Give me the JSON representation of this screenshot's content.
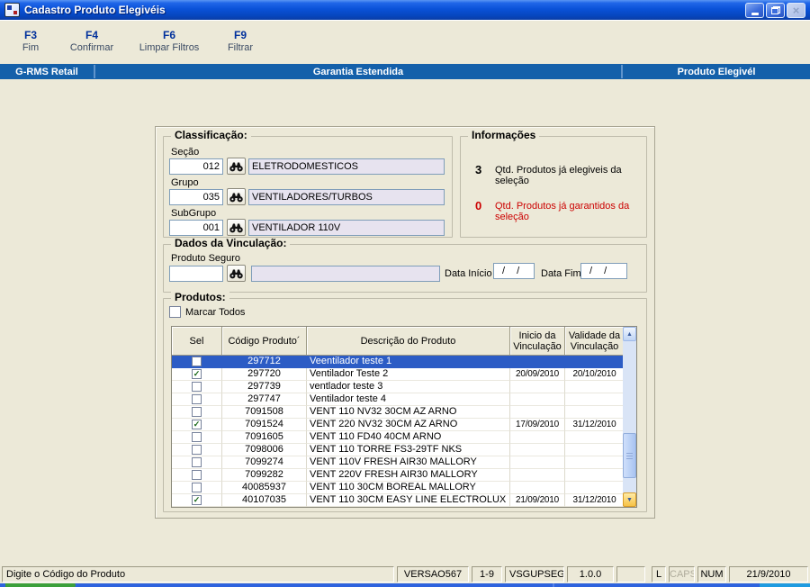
{
  "window": {
    "title": "Cadastro Produto Elegivéis"
  },
  "toolbar": {
    "buttons": [
      {
        "key": "F3",
        "label": "Fim"
      },
      {
        "key": "F4",
        "label": "Confirmar"
      },
      {
        "key": "F6",
        "label": "Limpar Filtros"
      },
      {
        "key": "F9",
        "label": "Filtrar"
      }
    ]
  },
  "banner": {
    "left": "G-RMS Retail",
    "center": "Garantia Estendida",
    "right": "Produto Elegivél"
  },
  "classificacao": {
    "title": "Classificação:",
    "secao": {
      "label": "Seção",
      "code": "012",
      "description": "ELETRODOMESTICOS"
    },
    "grupo": {
      "label": "Grupo",
      "code": "035",
      "description": "VENTILADORES/TURBOS"
    },
    "subgrupo": {
      "label": "SubGrupo",
      "code": "001",
      "description": "VENTILADOR 110V"
    }
  },
  "informacoes": {
    "title": "Informações",
    "elegiveis": {
      "count": "3",
      "label": "Qtd. Produtos já elegiveis da seleção"
    },
    "garantidos": {
      "count": "0",
      "label": "Qtd. Produtos já garantidos da seleção"
    }
  },
  "vinculacao": {
    "title": "Dados da Vinculação:",
    "produto_seguro_label": "Produto Seguro",
    "produto_seguro_code": "",
    "produto_seguro_description": "",
    "data_inicio": {
      "label": "Data Início",
      "value": "/ /"
    },
    "data_fim": {
      "label": "Data Fim",
      "value": "/ /"
    }
  },
  "produtos": {
    "title": "Produtos:",
    "marcar_todos_label": "Marcar Todos",
    "columns": {
      "sel": "Sel",
      "codigo": "Código Produto",
      "sort_mark": "´",
      "descricao": "Descrição do Produto",
      "inicio": "Inicio da Vinculação",
      "validade": "Validade da Vinculação"
    },
    "rows": [
      {
        "checked": false,
        "selected": true,
        "code": "297712",
        "desc": "Veentilador teste 1",
        "start": "",
        "end": ""
      },
      {
        "checked": true,
        "selected": false,
        "code": "297720",
        "desc": "Ventilador Teste 2",
        "start": "20/09/2010",
        "end": "20/10/2010"
      },
      {
        "checked": false,
        "selected": false,
        "code": "297739",
        "desc": "ventlador teste 3",
        "start": "",
        "end": ""
      },
      {
        "checked": false,
        "selected": false,
        "code": "297747",
        "desc": "Ventilador teste 4",
        "start": "",
        "end": ""
      },
      {
        "checked": false,
        "selected": false,
        "code": "7091508",
        "desc": "VENT 110 NV32 30CM AZ ARNO",
        "start": "",
        "end": ""
      },
      {
        "checked": true,
        "selected": false,
        "code": "7091524",
        "desc": "VENT 220 NV32 30CM AZ ARNO",
        "start": "17/09/2010",
        "end": "31/12/2010"
      },
      {
        "checked": false,
        "selected": false,
        "code": "7091605",
        "desc": "VENT 110 FD40 40CM ARNO",
        "start": "",
        "end": ""
      },
      {
        "checked": false,
        "selected": false,
        "code": "7098006",
        "desc": "VENT 110 TORRE FS3-29TF NKS",
        "start": "",
        "end": ""
      },
      {
        "checked": false,
        "selected": false,
        "code": "7099274",
        "desc": "VENT 110V FRESH AIR30 MALLORY",
        "start": "",
        "end": ""
      },
      {
        "checked": false,
        "selected": false,
        "code": "7099282",
        "desc": "VENT 220V FRESH AIR30 MALLORY",
        "start": "",
        "end": ""
      },
      {
        "checked": false,
        "selected": false,
        "code": "40085937",
        "desc": "VENT 110 30CM BOREAL MALLORY",
        "start": "",
        "end": ""
      },
      {
        "checked": true,
        "selected": false,
        "code": "40107035",
        "desc": "VENT 110 30CM EASY LINE ELECTROLUX",
        "start": "21/09/2010",
        "end": "31/12/2010"
      }
    ]
  },
  "statusbar": {
    "message": "Digite o Código do Produto",
    "version": "VERSAO567",
    "range": "1-9",
    "module": "VSGUPSEG",
    "build": "1.0.0",
    "keyboard_l": "L",
    "caps": "CAPS",
    "num": "NUM",
    "date": "21/9/2010"
  },
  "icons": {
    "lookup": "binoculars",
    "scroll_up": "▲",
    "scroll_down": "▼"
  },
  "colors": {
    "selection_blue": "#2C5CC5",
    "banner_blue": "#1460AA",
    "alert_red": "#CC0000",
    "readonly_field": "#E7E3EF"
  }
}
